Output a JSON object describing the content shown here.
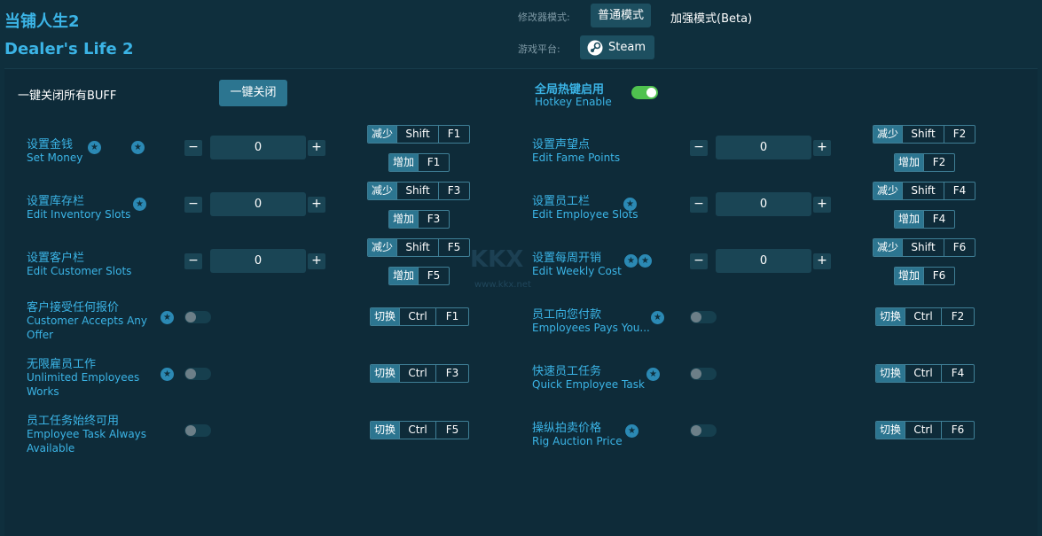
{
  "header": {
    "title_cn": "当铺人生2",
    "title_en": "Dealer's Life 2",
    "mode_label": "修改器模式:",
    "mode_normal": "普通模式",
    "mode_beta": "加强模式(Beta)",
    "platform_label": "游戏平台:",
    "platform_name": "Steam"
  },
  "toolbar": {
    "all_buff_label": "一键关闭所有BUFF",
    "close_all_label": "一键关闭",
    "hotkey_title": "全局热键启用",
    "hotkey_sub": "Hotkey Enable",
    "hotkey_enabled": true
  },
  "numeric_rows": [
    {
      "cn": "设置金钱",
      "en": "Set Money",
      "value": "0",
      "dec": [
        "减少",
        "Shift",
        "F1"
      ],
      "inc": [
        "增加",
        "F1"
      ]
    },
    {
      "cn": "设置声望点",
      "en": "Edit Fame Points",
      "value": "0",
      "dec": [
        "减少",
        "Shift",
        "F2"
      ],
      "inc": [
        "增加",
        "F2"
      ]
    },
    {
      "cn": "设置库存栏",
      "en": "Edit Inventory Slots",
      "value": "0",
      "dec": [
        "减少",
        "Shift",
        "F3"
      ],
      "inc": [
        "增加",
        "F3"
      ]
    },
    {
      "cn": "设置员工栏",
      "en": "Edit Employee Slots",
      "value": "0",
      "dec": [
        "减少",
        "Shift",
        "F4"
      ],
      "inc": [
        "增加",
        "F4"
      ]
    },
    {
      "cn": "设置客户栏",
      "en": "Edit Customer Slots",
      "value": "0",
      "dec": [
        "减少",
        "Shift",
        "F5"
      ],
      "inc": [
        "增加",
        "F5"
      ]
    },
    {
      "cn": "设置每周开销",
      "en": "Edit Weekly Cost",
      "value": "0",
      "dec": [
        "减少",
        "Shift",
        "F6"
      ],
      "inc": [
        "增加",
        "F6"
      ]
    }
  ],
  "toggle_rows": [
    {
      "cn": "客户接受任何报价",
      "en1": "Customer Accepts Any",
      "en2": "Offer",
      "keys": [
        "切换",
        "Ctrl",
        "F1"
      ],
      "on": false
    },
    {
      "cn": "员工向您付款",
      "en1": "Employees Pays You...",
      "en2": "",
      "keys": [
        "切换",
        "Ctrl",
        "F2"
      ],
      "on": false
    },
    {
      "cn": "无限雇员工作",
      "en1": "Unlimited Employees",
      "en2": "Works",
      "keys": [
        "切换",
        "Ctrl",
        "F3"
      ],
      "on": false
    },
    {
      "cn": "快速员工任务",
      "en1": "Quick Employee Task",
      "en2": "",
      "keys": [
        "切换",
        "Ctrl",
        "F4"
      ],
      "on": false
    },
    {
      "cn": "员工任务始终可用",
      "en1": "Employee Task Always",
      "en2": "Available",
      "keys": [
        "切换",
        "Ctrl",
        "F5"
      ],
      "on": false
    },
    {
      "cn": "操纵拍卖价格",
      "en1": "Rig Auction Price",
      "en2": "",
      "keys": [
        "切换",
        "Ctrl",
        "F6"
      ],
      "on": false
    }
  ],
  "watermark": {
    "logo": "KKX",
    "url": "www.kkx.net"
  },
  "colors": {
    "accent": "#3bb4e6",
    "background": "#0f2f3d",
    "toggle_on": "#4fc24f",
    "key_label_bg": "#2c7590"
  }
}
